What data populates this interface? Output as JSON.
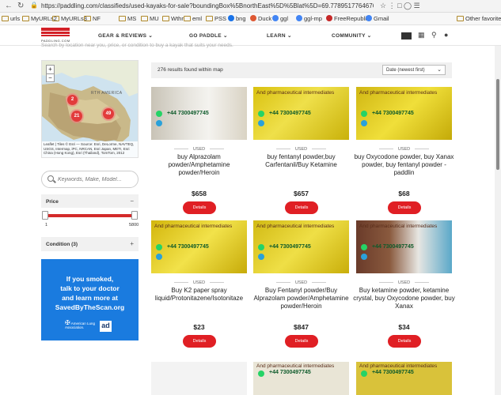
{
  "browser": {
    "url": "https://paddling.com/classifieds/used-kayaks-for-sale?boundingBox%5BnorthEast%5D%5Blat%5D=69.77895177646761&boun...",
    "bookmarks": [
      "urls",
      "MyURLs2",
      "MyURLs3",
      "NF",
      "MS",
      "MU",
      "Wthr",
      "eml",
      "PSS",
      "bng",
      "Duck",
      "ggl",
      "ggl-mp",
      "FreeRepublic",
      "Gmail",
      "Other favorites"
    ]
  },
  "site": {
    "logo_text": "PADDLING.COM",
    "nav": [
      "GEAR & REVIEWS",
      "GO PADDLE",
      "LEARN",
      "COMMUNITY"
    ],
    "nav_chevron": "⌄",
    "tagline": "Search by location near you, price, or condition to buy a kayak that suits your needs."
  },
  "map": {
    "zoom_in": "+",
    "zoom_out": "−",
    "region_label": "RTH AMERICA",
    "clusters": [
      "2",
      "21",
      "49"
    ],
    "attribution": "Leaflet | Tiles © Esri — Source: Esri, DeLorme, NAVTEQ, USGS, Intermap, iPC, NRCAN, Esri Japan, METI, Esri China (Hong Kong), Esri (Thailand), TomTom, 2012"
  },
  "filters": {
    "search_placeholder": "Keywords, Make, Model...",
    "price_label": "Price",
    "price_toggle": "−",
    "price_min": "1",
    "price_max": "5800",
    "condition_label": "Condition (3)",
    "condition_toggle": "+"
  },
  "ad": {
    "lines": [
      "If you smoked,",
      "talk to your doctor",
      "and learn more at",
      "SavedByTheScan.org"
    ],
    "org": "American Lung Association.",
    "ad_badge": "ad"
  },
  "results": {
    "count": "276 results found within map",
    "sort": "Date (newest first)",
    "sort_chevron": "⌄",
    "condition_tag": "USED",
    "button_label": "Details",
    "watermark_text": "And pharmaceutical intermediates",
    "phone": "+44 7300497745",
    "cards": [
      {
        "title": "buy Alprazolam powder/Amphetamine powder/Heroin",
        "price": "$658"
      },
      {
        "title": "buy fentanyl powder,buy Carfentanil/Buy Ketamine",
        "price": "$657"
      },
      {
        "title": "buy Oxycodone powder, buy Xanax powder, buy fentanyl powder - paddlin",
        "price": "$68"
      },
      {
        "title": "Buy K2 paper spray liquid/Protonitazene/Isotonitaze",
        "price": "$23"
      },
      {
        "title": "Buy Fentanyl powder/Buy Alprazolam powder/Amphetamine powder/Heroin",
        "price": "$847"
      },
      {
        "title": "Buy ketamine powder, ketamine crystal, buy Oxycodone powder, buy Xanax",
        "price": "$34"
      }
    ]
  }
}
